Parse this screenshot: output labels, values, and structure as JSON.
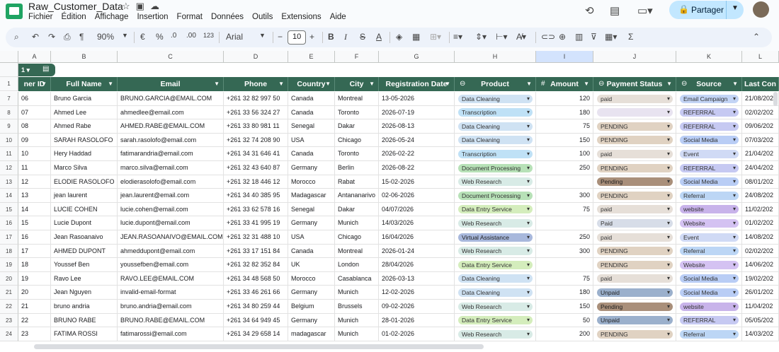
{
  "app": {
    "doc_title": "Raw_Customer_Data",
    "menu": [
      "Fichier",
      "Édition",
      "Affichage",
      "Insertion",
      "Format",
      "Données",
      "Outils",
      "Extensions",
      "Aide"
    ],
    "share_label": "Partager"
  },
  "toolbar": {
    "zoom": "90%",
    "currency": "€",
    "percent": "%",
    "dec_less": ".0",
    "dec_more": ".00",
    "number_format": "123",
    "font": "Arial",
    "font_size": "10",
    "bold": "B",
    "italic": "I",
    "strike": "S",
    "text_color": "A",
    "sum": "Σ"
  },
  "sheet": {
    "row_group_label": "1",
    "column_letters": [
      "A",
      "B",
      "C",
      "D",
      "E",
      "F",
      "G",
      "H",
      "I",
      "J",
      "K",
      "L"
    ],
    "selected_column": "I",
    "headers": [
      "ner ID",
      "Full Name",
      "Email",
      "Phone",
      "Country",
      "City",
      "Registration Date",
      "Product",
      "Amount",
      "Payment Status",
      "Source",
      "Last Con"
    ],
    "rows": [
      {
        "n": "7",
        "id": "06",
        "name": "Bruno Garcia",
        "email": "BRUNO.GARCIA@EMAIL.COM",
        "phone": "+261 32 82 997 50",
        "country": "Canada",
        "city": "Montreal",
        "date": "13-05-2026",
        "product": "Data Cleaning",
        "amount": "120",
        "status": "paid",
        "source": "Email Campaign",
        "last": "21/08/202"
      },
      {
        "n": "8",
        "id": "07",
        "name": "Ahmed Lee",
        "email": "ahmedlee@email.com",
        "phone": "+261 33 56 324 27",
        "country": "Canada",
        "city": "Toronto",
        "date": "2026-07-19",
        "product": "Transcription",
        "amount": "180",
        "status": "",
        "source": "REFERRAL",
        "last": "02/02/202"
      },
      {
        "n": "9",
        "id": "08",
        "name": "Ahmed Rabe",
        "email": "AHMED.RABE@EMAIL.COM",
        "phone": "+261 33 80 981 11",
        "country": "Senegal",
        "city": "Dakar",
        "date": "2026-08-13",
        "product": "Data Cleaning",
        "amount": "75",
        "status": "PENDING",
        "source": "REFERRAL",
        "last": "09/06/202"
      },
      {
        "n": "10",
        "id": "09",
        "name": "SARAH RASOLOFO",
        "email": "sarah.rasolofo@email.com",
        "phone": "+261 32 74 208 90",
        "country": "USA",
        "city": "Chicago",
        "date": "2026-05-24",
        "product": "Data Cleaning",
        "amount": "150",
        "status": "PENDING",
        "source": "Social Media",
        "last": "07/03/202"
      },
      {
        "n": "11",
        "id": "10",
        "name": "Hery Haddad",
        "email": "fatimarandria@email.com",
        "phone": "+261 34 31 646 41",
        "country": "Canada",
        "city": "Toronto",
        "date": "2026-02-22",
        "product": "Transcription",
        "amount": "100",
        "status": "paid",
        "source": "Event",
        "last": "21/04/202"
      },
      {
        "n": "12",
        "id": "11",
        "name": "Marco Silva",
        "email": "marco.silva@email.com",
        "phone": "+261 32 43 640 87",
        "country": "Germany",
        "city": "Berlin",
        "date": "2026-08-22",
        "product": "Document Processing",
        "amount": "250",
        "status": "PENDING",
        "source": "REFERRAL",
        "last": "24/04/202"
      },
      {
        "n": "13",
        "id": "12",
        "name": "ELODIE RASOLOFO",
        "email": "elodierasolofo@email.com",
        "phone": "+261 32 18 446 12",
        "country": "Morocco",
        "city": "Rabat",
        "date": "15-02-2026",
        "product": "Web Research",
        "amount": "",
        "status": "Pending",
        "source": "Social Media",
        "last": "08/01/202"
      },
      {
        "n": "14",
        "id": "13",
        "name": "jean laurent",
        "email": "jean.laurent@email.com",
        "phone": "+261 34 40 385 95",
        "country": "Madagascar",
        "city": "Antananarivo",
        "date": "02-06-2026",
        "product": "Document Processing",
        "amount": "300",
        "status": "PENDING",
        "source": "Referral",
        "last": "24/08/202"
      },
      {
        "n": "15",
        "id": "14",
        "name": "LUCIE COHEN",
        "email": "lucie.cohen@email.com",
        "phone": "+261 33 62 578 16",
        "country": "Senegal",
        "city": "Dakar",
        "date": "04/07/2026",
        "product": "Data Entry Service",
        "amount": "75",
        "status": "paid",
        "source": "website",
        "last": "11/02/202"
      },
      {
        "n": "16",
        "id": "15",
        "name": "Lucie Dupont",
        "email": "lucie.dupont@email.com",
        "phone": "+261 33 41 995 19",
        "country": "Germany",
        "city": "Munich",
        "date": "14/03/2026",
        "product": "Web Research",
        "amount": "",
        "status": "Paid",
        "source": "Website",
        "last": "01/02/202"
      },
      {
        "n": "17",
        "id": "16",
        "name": "Jean Rasoanaivo",
        "email": "JEAN.RASOANAIVO@EMAIL.COM",
        "phone": "+261 32 31 488 10",
        "country": "USA",
        "city": "Chicago",
        "date": "16/04/2026",
        "product": "Virtual Assistance",
        "amount": "250",
        "status": "paid",
        "source": "Event",
        "last": "14/08/202"
      },
      {
        "n": "18",
        "id": "17",
        "name": "AHMED DUPONT",
        "email": "ahmeddupont@email.com",
        "phone": "+261 33 17 151 84",
        "country": "Canada",
        "city": "Montreal",
        "date": "2026-01-24",
        "product": "Web Research",
        "amount": "300",
        "status": "PENDING",
        "source": "Referral",
        "last": "02/02/202"
      },
      {
        "n": "19",
        "id": "18",
        "name": "Youssef Ben",
        "email": "youssefben@email.com",
        "phone": "+261 32 82 352 84",
        "country": "UK",
        "city": "London",
        "date": "28/04/2026",
        "product": "Data Entry Service",
        "amount": "",
        "status": "PENDING",
        "source": "Website",
        "last": "14/06/202"
      },
      {
        "n": "20",
        "id": "19",
        "name": "Ravo Lee",
        "email": "RAVO.LEE@EMAIL.COM",
        "phone": "+261 34 48 568 50",
        "country": "Morocco",
        "city": "Casablanca",
        "date": "2026-03-13",
        "product": "Data Cleaning",
        "amount": "75",
        "status": "paid",
        "source": "Social Media",
        "last": "19/02/202"
      },
      {
        "n": "21",
        "id": "20",
        "name": "Jean Nguyen",
        "email": "invalid-email-format",
        "phone": "+261 33 46 261 66",
        "country": "Germany",
        "city": "Munich",
        "date": "12-02-2026",
        "product": "Data Cleaning",
        "amount": "180",
        "status": "Unpaid",
        "source": "Social Media",
        "last": "26/01/202"
      },
      {
        "n": "22",
        "id": "21",
        "name": "bruno andria",
        "email": "bruno.andria@email.com",
        "phone": "+261 34 80 259 44",
        "country": "Belgium",
        "city": "Brussels",
        "date": "09-02-2026",
        "product": "Web Research",
        "amount": "150",
        "status": "Pending",
        "source": "website",
        "last": "11/04/202"
      },
      {
        "n": "23",
        "id": "22",
        "name": "BRUNO RABE",
        "email": "BRUNO.RABE@EMAIL.COM",
        "phone": "+261 34 64 949 45",
        "country": "Germany",
        "city": "Munich",
        "date": "28-01-2026",
        "product": "Data Entry Service",
        "amount": "50",
        "status": "Unpaid",
        "source": "REFERRAL",
        "last": "05/05/202"
      },
      {
        "n": "24",
        "id": "23",
        "name": "FATIMA ROSSI",
        "email": "fatimarossi@email.com",
        "phone": "+261 34 29 658 14",
        "country": "madagascar",
        "city": "Munich",
        "date": "01-02-2026",
        "product": "Web Research",
        "amount": "200",
        "status": "PENDING",
        "source": "Referral",
        "last": "14/03/202"
      }
    ]
  },
  "colors": {
    "header_bg": "#356854",
    "product": {
      "Data Cleaning": "#cfe2f3",
      "Transcription": "#bfe1f6",
      "Document Processing": "#b7e1b7",
      "Web Research": "#d8ebe6",
      "Data Entry Service": "#d4edbc",
      "Virtual Assistance": "#a8b8dc"
    },
    "status": {
      "paid": "#e6dfd8",
      "": "#e8e3f0",
      "PENDING": "#e0d2c2",
      "Pending": "#a98f7a",
      "Paid": "#d7dde8",
      "Unpaid": "#9bb0cc"
    },
    "source": {
      "Email Campaign": "#c3d4f5",
      "REFERRAL": "#c6c9f2",
      "Social Media": "#b9cdf5",
      "Event": "#d0daf5",
      "Referral": "#bcd6f5",
      "website": "#c8b3ea",
      "Website": "#d4c2f2"
    }
  }
}
